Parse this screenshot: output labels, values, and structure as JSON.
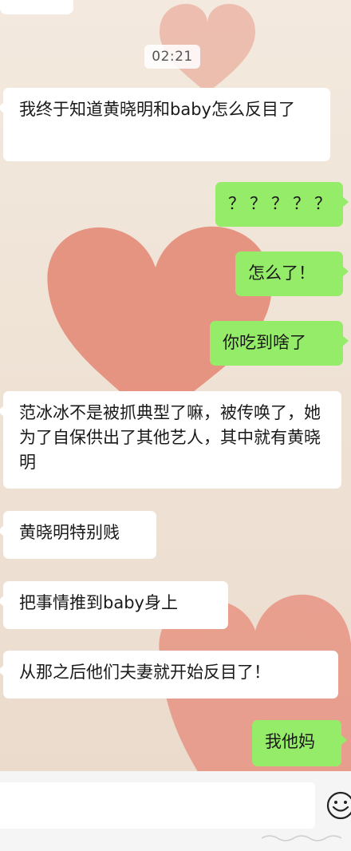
{
  "timestamp": "02:21",
  "messages": [
    {
      "side": "in",
      "text": "我终于知道黄晓明和baby怎么反目了"
    },
    {
      "side": "out",
      "text": "？？？？？"
    },
    {
      "side": "out",
      "text": "怎么了！"
    },
    {
      "side": "out",
      "text": "你吃到啥了"
    },
    {
      "side": "in",
      "text": "范冰冰不是被抓典型了嘛，被传唤了，她为了自保供出了其他艺人，其中就有黄晓明"
    },
    {
      "side": "in",
      "text": "黄晓明特别贱"
    },
    {
      "side": "in",
      "text": "把事情推到baby身上"
    },
    {
      "side": "in",
      "text": "从那之后他们夫妻就开始反目了！"
    },
    {
      "side": "out",
      "text": "我他妈"
    }
  ],
  "input": {
    "placeholder": ""
  },
  "icons": {
    "emoji": "smiley-face-icon"
  },
  "colors": {
    "outgoing_bubble": "#95ec69",
    "incoming_bubble": "#ffffff",
    "heart": "#e58a78"
  }
}
